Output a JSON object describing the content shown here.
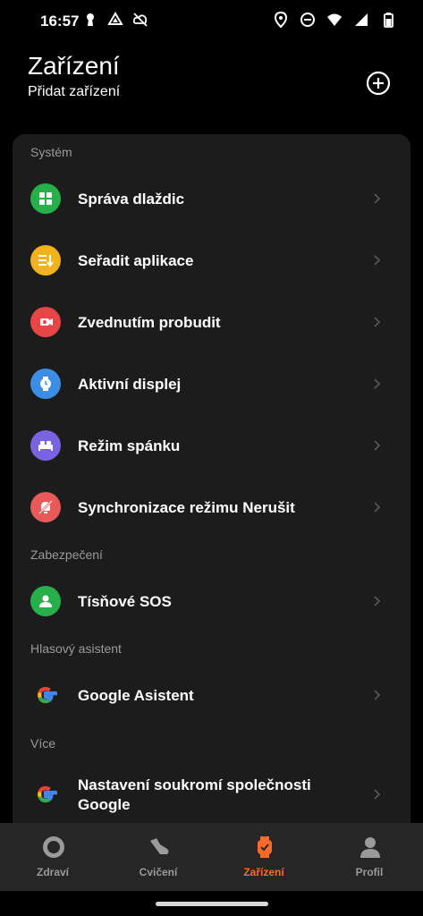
{
  "status_bar": {
    "time": "16:57"
  },
  "header": {
    "title": "Zařízení",
    "subtitle": "Přidat zařízení"
  },
  "sections": {
    "system": "Systém",
    "security": "Zabezpečení",
    "assistant": "Hlasový asistent",
    "more": "Více"
  },
  "items": {
    "tiles": "Správa dlaždic",
    "sort_apps": "Seřadit aplikace",
    "raise_to_wake": "Zvednutím probudit",
    "active_display": "Aktivní displej",
    "sleep_mode": "Režim spánku",
    "dnd_sync": "Synchronizace režimu Nerušit",
    "sos": "Tísňové SOS",
    "google_assistant": "Google Asistent",
    "google_privacy_line1": "Nastavení soukromí společnosti",
    "google_privacy_line2": "Google"
  },
  "icon_colors": {
    "tiles": "#27b04a",
    "sort_apps": "#f2b21b",
    "raise_to_wake": "#e84545",
    "active_display": "#3a8ee6",
    "sleep_mode": "#7a63e0",
    "dnd_sync": "#e85a5a",
    "sos": "#27b04a"
  },
  "bottom_nav": {
    "health": "Zdraví",
    "workout": "Cvičení",
    "device": "Zařízení",
    "profile": "Profil",
    "active_color": "#ff6a2b"
  }
}
